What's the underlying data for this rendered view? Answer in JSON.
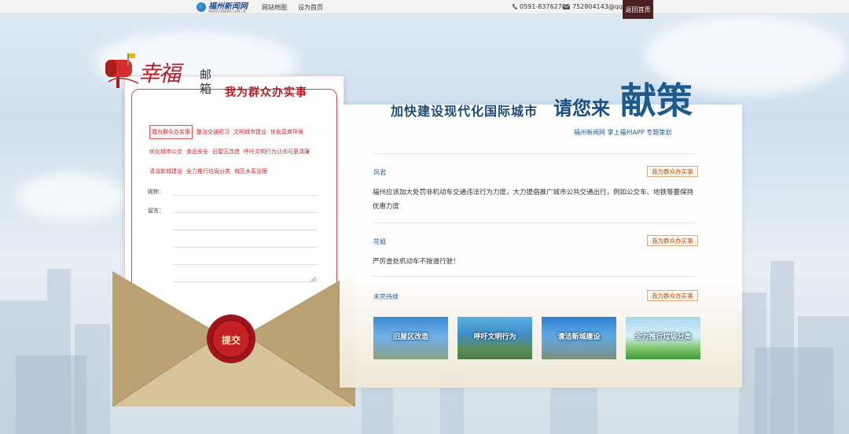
{
  "topbar": {
    "logo_name": "福州新闻网",
    "logo_sub": "WWW.FZNEWS.COM.CN",
    "site_map": "网站地图",
    "set_home": "设为首页",
    "phone": "0591-83762780",
    "email": "752804143@qq.com",
    "back_home": "返回首页"
  },
  "brand": {
    "title": "幸福",
    "sub": "邮箱",
    "letter_title": "我为群众办实事"
  },
  "topics": [
    "我为群众办实事",
    "整治交通陋习",
    "文明城市建设",
    "优化营商环境",
    "优化城市公交",
    "食品安全",
    "旧屋区改造",
    "呼吁文明行为让向可更清廉",
    "清洁新城建设",
    "全力推行垃圾分类",
    "城区水系治理"
  ],
  "form": {
    "nickname_label": "昵称：",
    "message_label": "留言：",
    "submit": "提交"
  },
  "header": {
    "line1": "加快建设现代化国际城市",
    "line2": "请您来",
    "line3": "献策",
    "credits": "福州新闻网  掌上福州APP  专题策划"
  },
  "messages": [
    {
      "name": "风君",
      "tag": "我为群众办实事",
      "body": "福州应该加大处罚非机动车交通违法行为力度，大力提倡推广城市公共交通出行，例如公交车、地铁等要保持优惠力度"
    },
    {
      "name": "花姐",
      "tag": "我为群众办实事",
      "body": "严厉查处机动车不按道行驶！"
    },
    {
      "name": "未完待续",
      "tag": "我为群众办实事",
      "body": ""
    }
  ],
  "thumbs": [
    {
      "label": "旧屋区改造"
    },
    {
      "label": "呼吁文明行为"
    },
    {
      "label": "清洁新城建设"
    },
    {
      "label": "全力推行垃圾分类"
    }
  ]
}
